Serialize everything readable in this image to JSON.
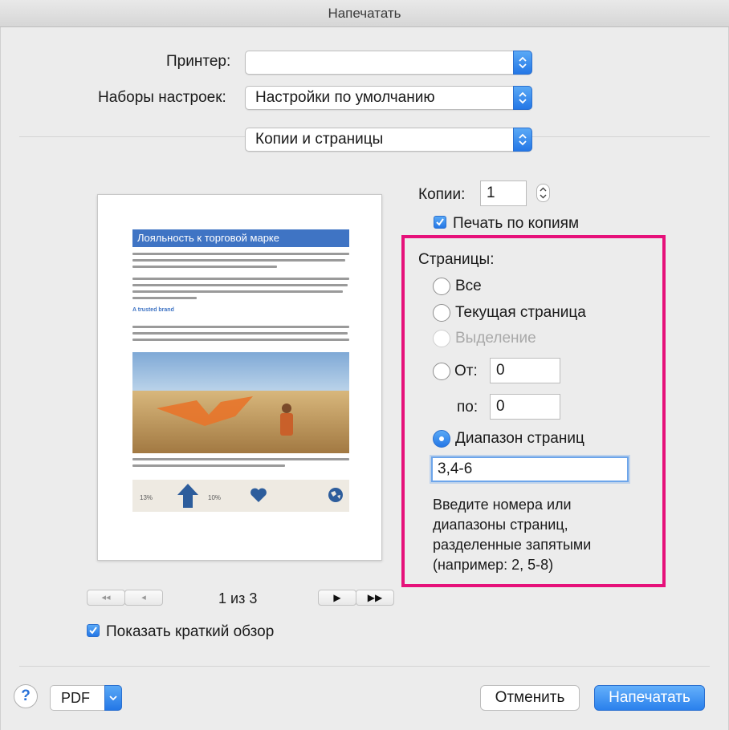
{
  "window": {
    "title": "Напечатать"
  },
  "printer": {
    "label": "Принтер:",
    "value": ""
  },
  "presets": {
    "label": "Наборы настроек:",
    "value": "Настройки по умолчанию"
  },
  "section": {
    "value": "Копии и страницы"
  },
  "preview": {
    "doc_title": "Лояльность к торговой марке",
    "doc_subtitle": "A trusted brand",
    "stat1": "13%",
    "stat2": "10%",
    "page_indicator": "1 из 3",
    "first_btn": "◂◂",
    "prev_btn": "◂",
    "next_btn": "▶",
    "last_btn": "▶▶"
  },
  "copies": {
    "label": "Копии:",
    "value": "1",
    "collate_label": "Печать по копиям",
    "collate_checked": true
  },
  "pages": {
    "label": "Страницы:",
    "all": "Все",
    "current": "Текущая страница",
    "selection": "Выделение",
    "from_label": "От:",
    "from_value": "0",
    "to_label": "по:",
    "to_value": "0",
    "range_label": "Диапазон страниц",
    "range_value": "3,4-6",
    "hint": "Введите номера или диапазоны страниц, разделенные запятыми (например: 2, 5-8)",
    "selected": "range"
  },
  "summary": {
    "label": "Показать краткий обзор",
    "checked": true
  },
  "footer": {
    "help": "?",
    "pdf": "PDF",
    "cancel": "Отменить",
    "print": "Напечатать"
  },
  "colors": {
    "accent": "#2477e6",
    "highlight": "#e6117a"
  }
}
